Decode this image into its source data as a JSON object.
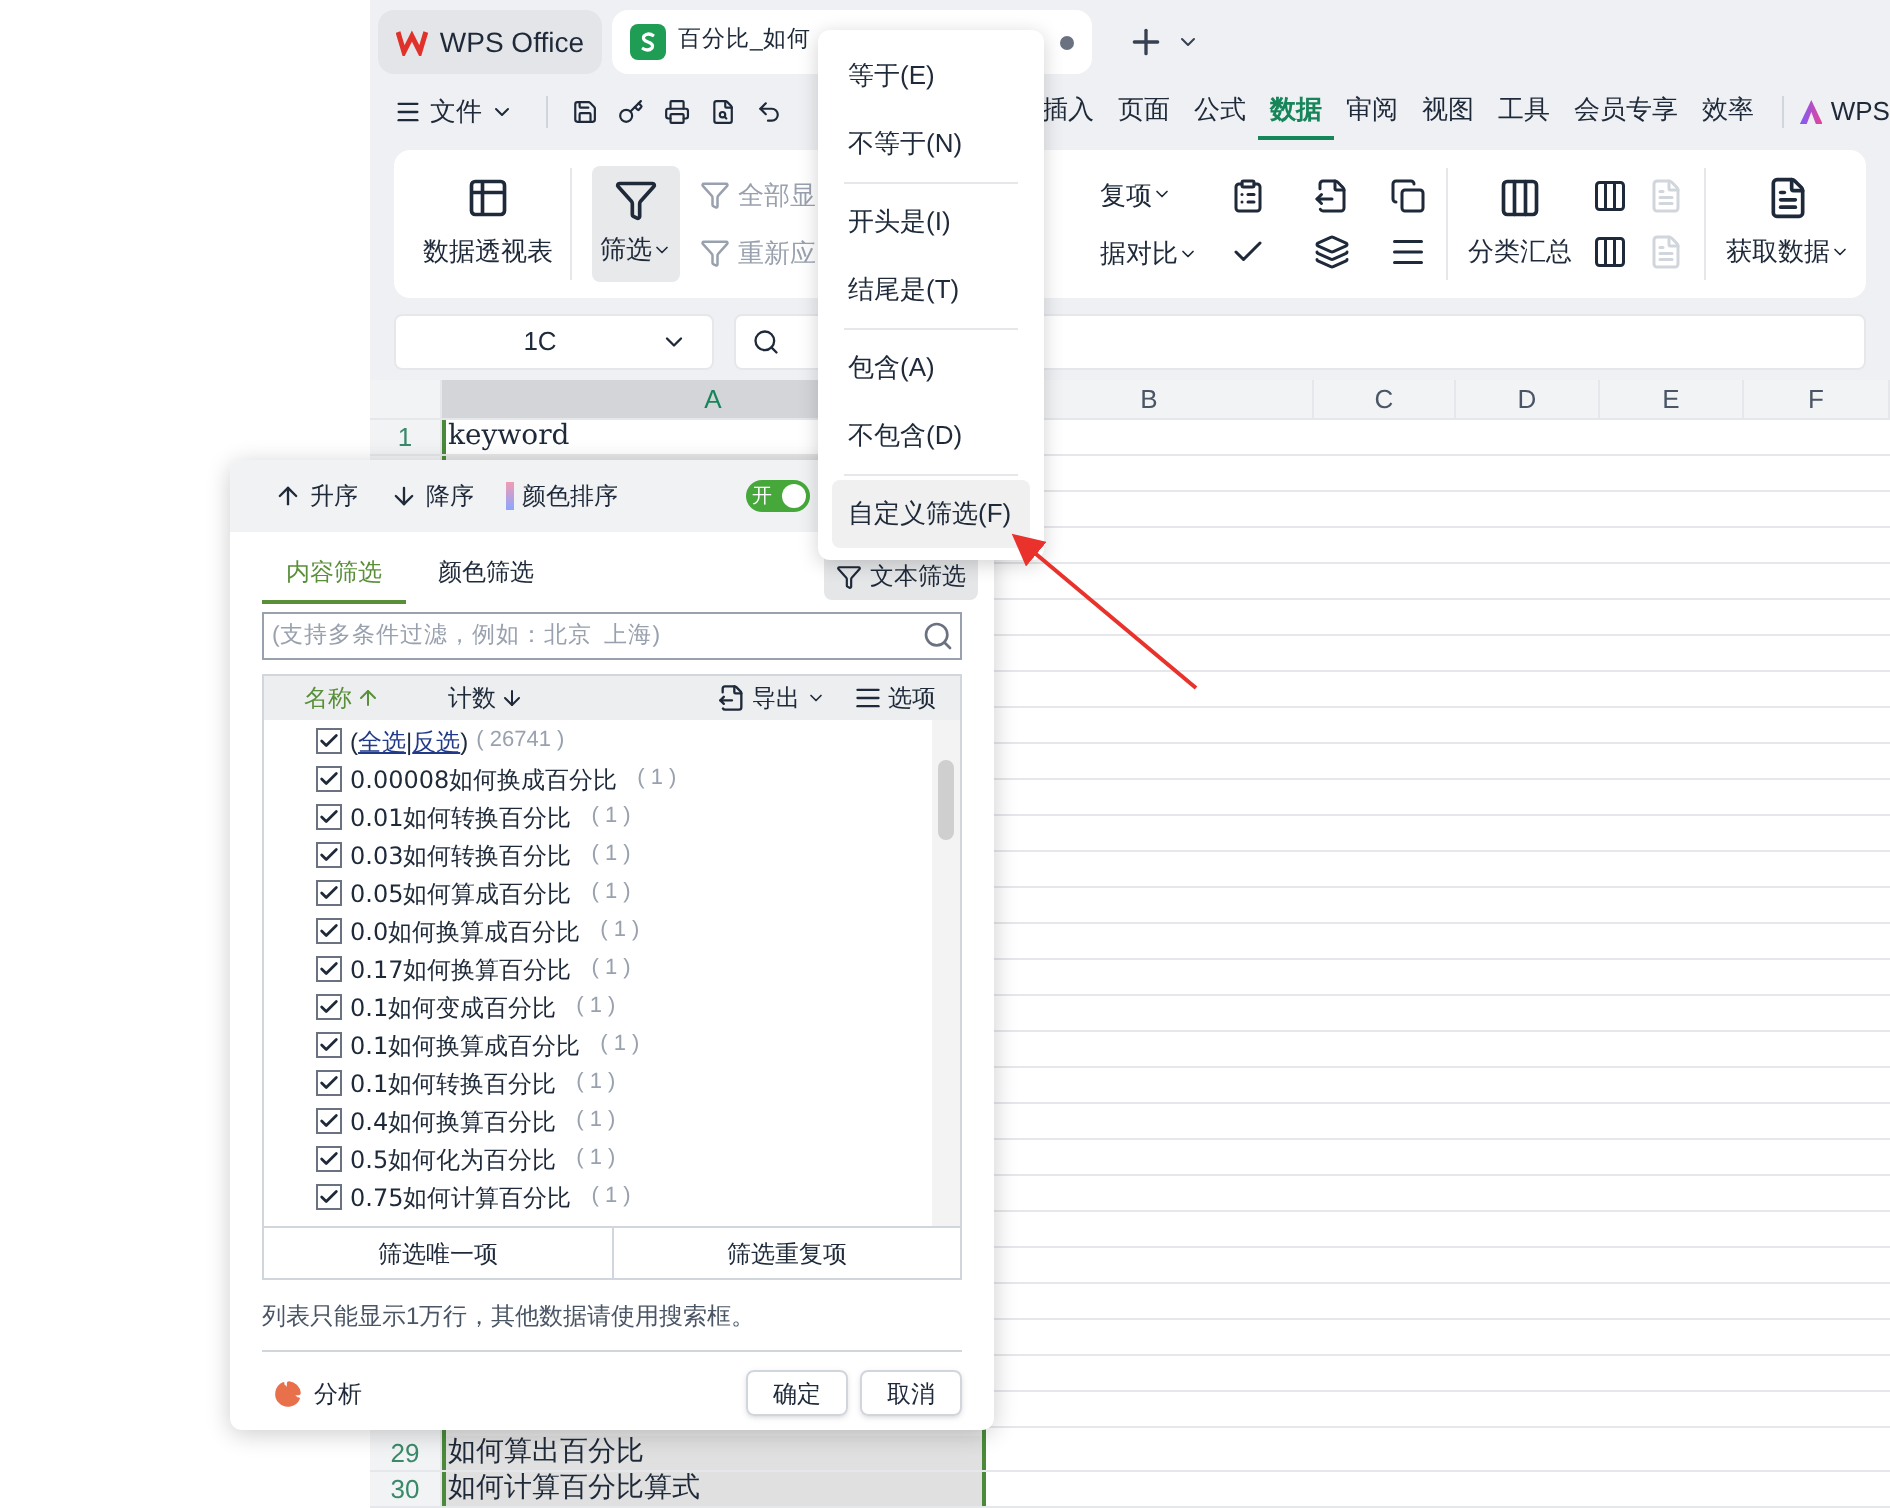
{
  "tabs": [
    {
      "kind": "home",
      "label": "WPS Office",
      "selected": false
    },
    {
      "kind": "sheet",
      "label": "百分比_如何",
      "selected": true,
      "unsaved": true
    }
  ],
  "menu_bar": {
    "file": "文件",
    "items": [
      {
        "label": "插入",
        "selected": false
      },
      {
        "label": "页面",
        "selected": false
      },
      {
        "label": "公式",
        "selected": false
      },
      {
        "label": "数据",
        "selected": true
      },
      {
        "label": "审阅",
        "selected": false
      },
      {
        "label": "视图",
        "selected": false
      },
      {
        "label": "工具",
        "selected": false
      },
      {
        "label": "会员专享",
        "selected": false
      },
      {
        "label": "效率",
        "selected": false
      }
    ],
    "brand": "WPS"
  },
  "ribbon": {
    "pivot": "数据透视表",
    "filter": "筛选",
    "show_all": {
      "label": "全部显",
      "disabled": true
    },
    "reapply": {
      "label": "重新应",
      "disabled": true
    },
    "duplicates": "复项",
    "compare": "据对比",
    "subtotal": "分类汇总",
    "get_data": "获取数据"
  },
  "name_box": "1C",
  "columns": [
    {
      "label": "A",
      "selected": true
    },
    {
      "label": "B",
      "selected": false
    },
    {
      "label": "C",
      "selected": false
    },
    {
      "label": "D",
      "selected": false
    },
    {
      "label": "E",
      "selected": false
    },
    {
      "label": "F",
      "selected": false
    }
  ],
  "rows_top": [
    {
      "number": "1",
      "value": "keyword",
      "active": true
    }
  ],
  "rows_bottom": [
    {
      "number": "29",
      "value": "如何算出百分比",
      "active": false
    },
    {
      "number": "30",
      "value": "如何计算百分比算式",
      "active": false
    }
  ],
  "filter_dialog": {
    "sort_asc": "升序",
    "sort_desc": "降序",
    "sort_color": "颜色排序",
    "toggle": {
      "label": "开",
      "on": true
    },
    "tabs": [
      {
        "label": "内容筛选",
        "selected": true
      },
      {
        "label": "颜色筛选",
        "selected": false
      }
    ],
    "text_filter": {
      "label": "文本筛选",
      "pressed": true
    },
    "search": {
      "placeholder": "(支持多条件过滤，例如：北京  上海)"
    },
    "list_header": {
      "name": "名称",
      "count": "计数",
      "export": "导出",
      "options": "选项"
    },
    "select_all": {
      "prefix": "(",
      "select": "全选",
      "separator": "|",
      "invert": "反选",
      "suffix": ")",
      "count": "( 26741 )",
      "checked": true
    },
    "items": [
      {
        "label": "0.00008如何换成百分比",
        "count": "( 1 )",
        "checked": true
      },
      {
        "label": "0.01如何转换百分比",
        "count": "( 1 )",
        "checked": true
      },
      {
        "label": "0.03如何转换百分比",
        "count": "( 1 )",
        "checked": true
      },
      {
        "label": "0.05如何算成百分比",
        "count": "( 1 )",
        "checked": true
      },
      {
        "label": "0.0如何换算成百分比",
        "count": "( 1 )",
        "checked": true
      },
      {
        "label": "0.17如何换算百分比",
        "count": "( 1 )",
        "checked": true
      },
      {
        "label": "0.1如何变成百分比",
        "count": "( 1 )",
        "checked": true
      },
      {
        "label": "0.1如何换算成百分比",
        "count": "( 1 )",
        "checked": true
      },
      {
        "label": "0.1如何转换百分比",
        "count": "( 1 )",
        "checked": true
      },
      {
        "label": "0.4如何换算百分比",
        "count": "( 1 )",
        "checked": true
      },
      {
        "label": "0.5如何化为百分比",
        "count": "( 1 )",
        "checked": true
      },
      {
        "label": "0.75如何计算百分比",
        "count": "( 1 )",
        "checked": true
      }
    ],
    "unique_button": "筛选唯一项",
    "duplicate_button": "筛选重复项",
    "note": "列表只能显示1万行，其他数据请使用搜索框。",
    "analyze": "分析",
    "ok": "确定",
    "cancel": "取消"
  },
  "dropdown_menu": {
    "groups": [
      [
        {
          "label": "等于(E)",
          "selected": false
        },
        {
          "label": "不等于(N)",
          "selected": false
        }
      ],
      [
        {
          "label": "开头是(I)",
          "selected": false
        },
        {
          "label": "结尾是(T)",
          "selected": false
        }
      ],
      [
        {
          "label": "包含(A)",
          "selected": false
        },
        {
          "label": "不包含(D)",
          "selected": false
        }
      ],
      [
        {
          "label": "自定义筛选(F)",
          "selected": true
        }
      ]
    ]
  }
}
